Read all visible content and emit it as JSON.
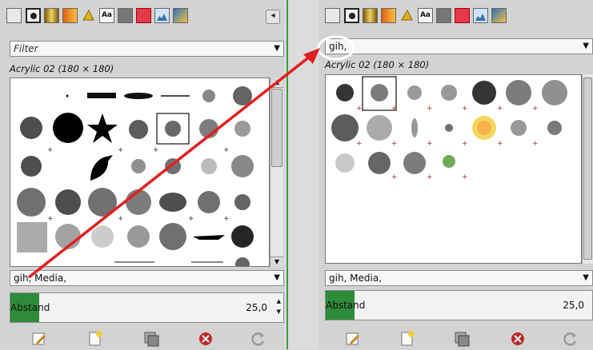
{
  "left_panel": {
    "filter_placeholder": "Filter",
    "brush_name": "Acrylic 02 (180 × 180)",
    "tag_value": "gih, Media,",
    "spacing_label": "Abstand",
    "spacing_value": "25,0"
  },
  "right_panel": {
    "filter_value": "gih,",
    "brush_name": "Acrylic 02 (180 × 180)",
    "tag_value": "gih, Media,",
    "spacing_label": "Abstand",
    "spacing_value": "25,0"
  },
  "annotation": {
    "color": "#e02020"
  }
}
